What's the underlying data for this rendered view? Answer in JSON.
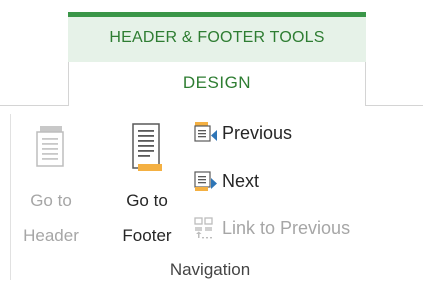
{
  "context_tab": {
    "label": "HEADER & FOOTER TOOLS"
  },
  "design_tab": {
    "label": "DESIGN"
  },
  "navigation_group": {
    "label": "Navigation",
    "go_to_header": {
      "line1": "Go to",
      "line2": "Header",
      "enabled": false,
      "icon": "go-to-header-icon"
    },
    "go_to_footer": {
      "line1": "Go to",
      "line2": "Footer",
      "enabled": true,
      "icon": "go-to-footer-icon"
    },
    "previous": {
      "label": "Previous",
      "enabled": true,
      "icon": "previous-section-icon"
    },
    "next": {
      "label": "Next",
      "enabled": true,
      "icon": "next-section-icon"
    },
    "link_to_previous": {
      "label": "Link to Previous",
      "enabled": false,
      "icon": "link-to-previous-icon"
    }
  },
  "colors": {
    "context_accent": "#3a9648",
    "context_background": "#e6f2e8",
    "context_text": "#2e7d32",
    "icon_orange": "#f4b042",
    "icon_blue": "#2e75b6",
    "disabled_text": "#a6a6a6"
  }
}
